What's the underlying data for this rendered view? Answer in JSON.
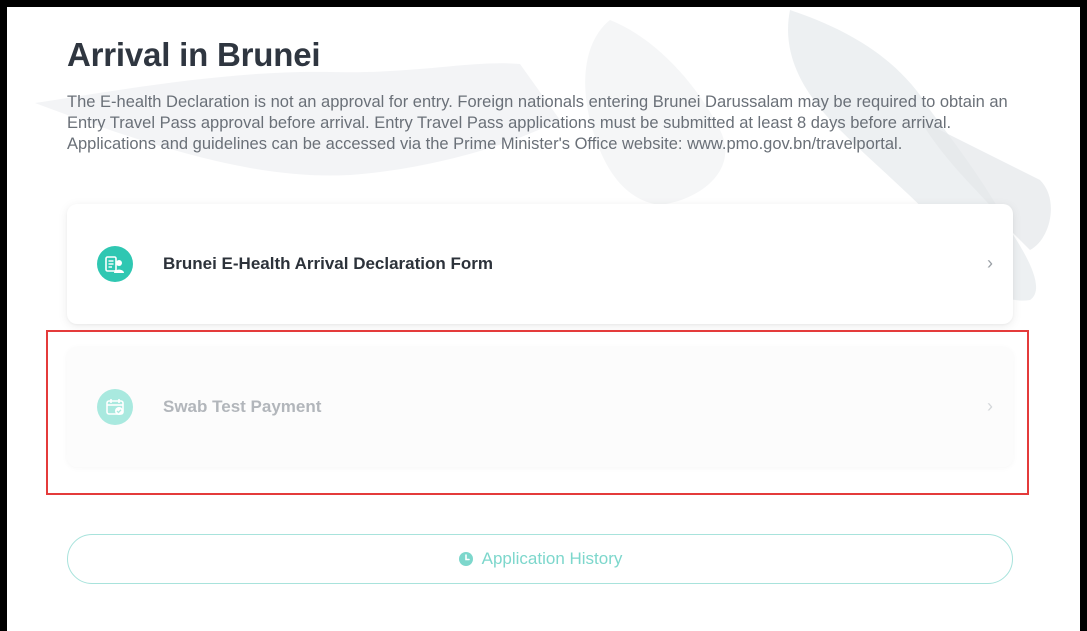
{
  "page": {
    "title": "Arrival in Brunei",
    "notice": "The E-health Declaration is not an approval for entry. Foreign nationals entering Brunei Darussalam may be required to obtain an Entry Travel Pass approval before arrival. Entry Travel Pass applications must be submitted at least 8 days before arrival. Applications and guidelines can be accessed via the Prime Minister's Office website: www.pmo.gov.bn/travelportal."
  },
  "cards": [
    {
      "label": "Brunei E-Health Arrival Declaration Form",
      "icon": "health-form-icon",
      "state": "enabled"
    },
    {
      "label": "Swab Test Payment",
      "icon": "calendar-check-icon",
      "state": "disabled"
    }
  ],
  "history_button": {
    "label": "Application History",
    "icon": "clock-icon"
  },
  "colors": {
    "accent": "#2fc7b2",
    "accent_light": "#a9e9df",
    "highlight": "#e43b3b",
    "title": "#2f3640"
  }
}
